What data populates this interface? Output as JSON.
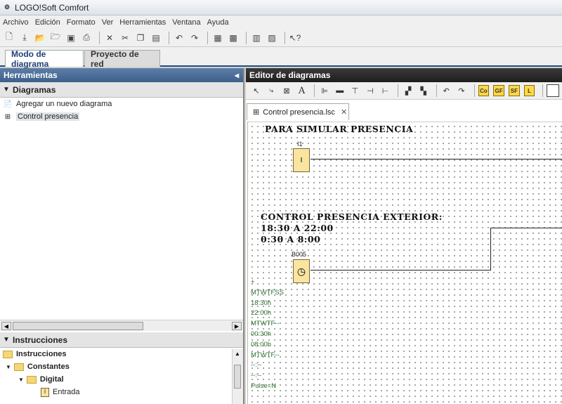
{
  "window": {
    "title": "LOGO!Soft Comfort"
  },
  "menu": [
    "Archivo",
    "Edición",
    "Formato",
    "Ver",
    "Herramientas",
    "Ventana",
    "Ayuda"
  ],
  "mode_tabs": {
    "active": "Modo de diagrama",
    "inactive": "Proyecto de red"
  },
  "left": {
    "header": "Herramientas",
    "diagrams_section": "Diagramas",
    "diagrams_items": [
      {
        "label": "Agregar un nuevo diagrama",
        "icon": "new-diagram-icon"
      },
      {
        "label": "Control presencia",
        "icon": "diagram-icon"
      }
    ],
    "instructions_section": "Instrucciones",
    "tree": {
      "root": "Instrucciones",
      "child": "Constantes",
      "grandchild": "Digital",
      "leaf": "Entrada"
    }
  },
  "editor": {
    "header": "Editor de diagramas",
    "doc_tab": "Control presencia.lsc",
    "fb_buttons": [
      "Co",
      "GF",
      "SF",
      "L"
    ],
    "text1": "PARA SIMULAR PRESENCIA",
    "text2_line1": "CONTROL PRESENCIA EXTERIOR:",
    "text2_line2": "18:30 A 22:00",
    "text2_line3": "0:30 A 8:00",
    "block1": {
      "name": "I1",
      "symbol": "I"
    },
    "block2": {
      "name": "B005",
      "symbol": "◷"
    },
    "params": [
      "+",
      "MTWTFSS",
      "18:30h",
      "22:00h",
      "MTWTF--",
      "00:30h",
      "08:00h",
      "MTWTF--",
      "--:--",
      "--:--",
      "Pulse=N"
    ]
  }
}
